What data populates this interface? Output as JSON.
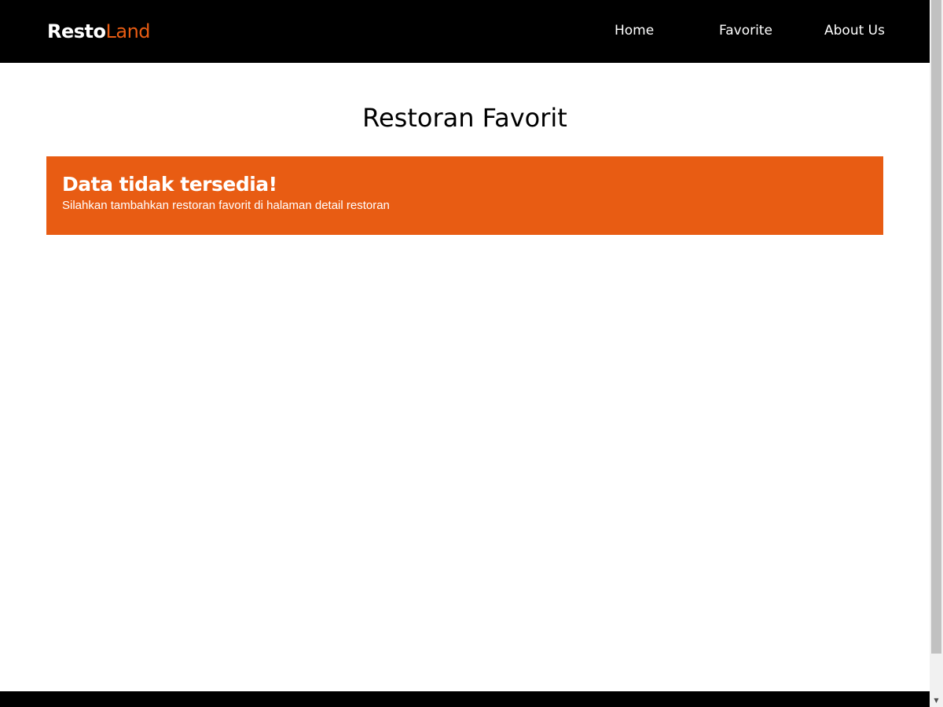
{
  "header": {
    "logo_part_1": "Resto",
    "logo_part_2": "Land",
    "nav": {
      "home": "Home",
      "favorite": "Favorite",
      "about": "About Us"
    }
  },
  "main": {
    "title": "Restoran Favorit",
    "empty_state": {
      "title": "Data tidak tersedia!",
      "message": "Silahkan tambahkan restoran favorit di halaman detail restoran"
    }
  },
  "scrollbar": {
    "down_arrow_icon": "▼"
  },
  "colors": {
    "accent": "#e85c13",
    "header_bg": "#000000",
    "footer_bg": "#000000",
    "page_bg": "#ffffff"
  }
}
